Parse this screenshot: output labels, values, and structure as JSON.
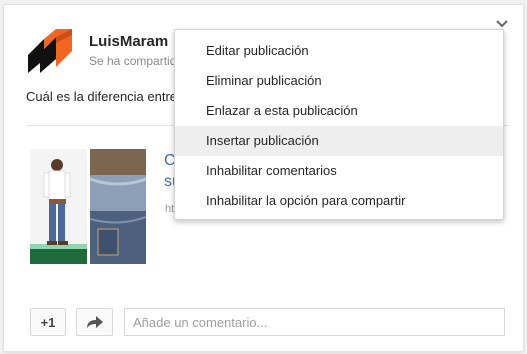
{
  "post": {
    "author": "LuisMaram",
    "subtitle": "Se ha compartido",
    "text": "Cuál es la diferencia entre",
    "link_title": "Cu",
    "link_title_line2": "su",
    "link_url": "htt"
  },
  "menu": {
    "items": [
      {
        "label": "Editar publicación"
      },
      {
        "label": "Eliminar publicación"
      },
      {
        "label": "Enlazar a esta publicación"
      },
      {
        "label": "Insertar publicación"
      },
      {
        "label": "Inhabilitar comentarios"
      },
      {
        "label": "Inhabilitar la opción para compartir"
      }
    ],
    "highlighted_index": 3
  },
  "actions": {
    "plus_one_label": "+1",
    "share_icon": "share-arrow-icon",
    "comment_placeholder": "Añade un comentario..."
  },
  "colors": {
    "brand_orange": "#f26522",
    "link_blue": "#3b6ec9",
    "menu_hover": "#eeeeee"
  }
}
